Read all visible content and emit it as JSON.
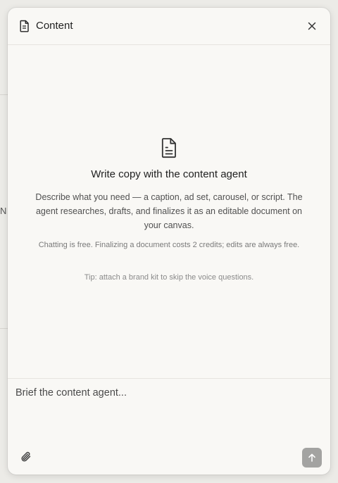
{
  "background": {
    "partial_letter": "N"
  },
  "header": {
    "icon": "document-icon",
    "title": "Content",
    "close_icon": "close-icon"
  },
  "empty_state": {
    "icon": "document-icon",
    "heading": "Write copy with the content agent",
    "description": "Describe what you need — a caption, ad set, carousel, or script. The agent researches, drafts, and finalizes it as an editable document on your canvas.",
    "pricing_note": "Chatting is free. Finalizing a document costs 2 credits; edits are always free.",
    "tip": "Tip: attach a brand kit to skip the voice questions."
  },
  "composer": {
    "placeholder": "Brief the content agent...",
    "value": "",
    "attach_icon": "paperclip-icon",
    "send_icon": "arrow-up-icon"
  },
  "colors": {
    "panel_bg": "#f9f8f5",
    "backdrop": "#ecebe7",
    "send_button_bg": "#a3a3a1",
    "text_primary": "#1f1f1f"
  }
}
